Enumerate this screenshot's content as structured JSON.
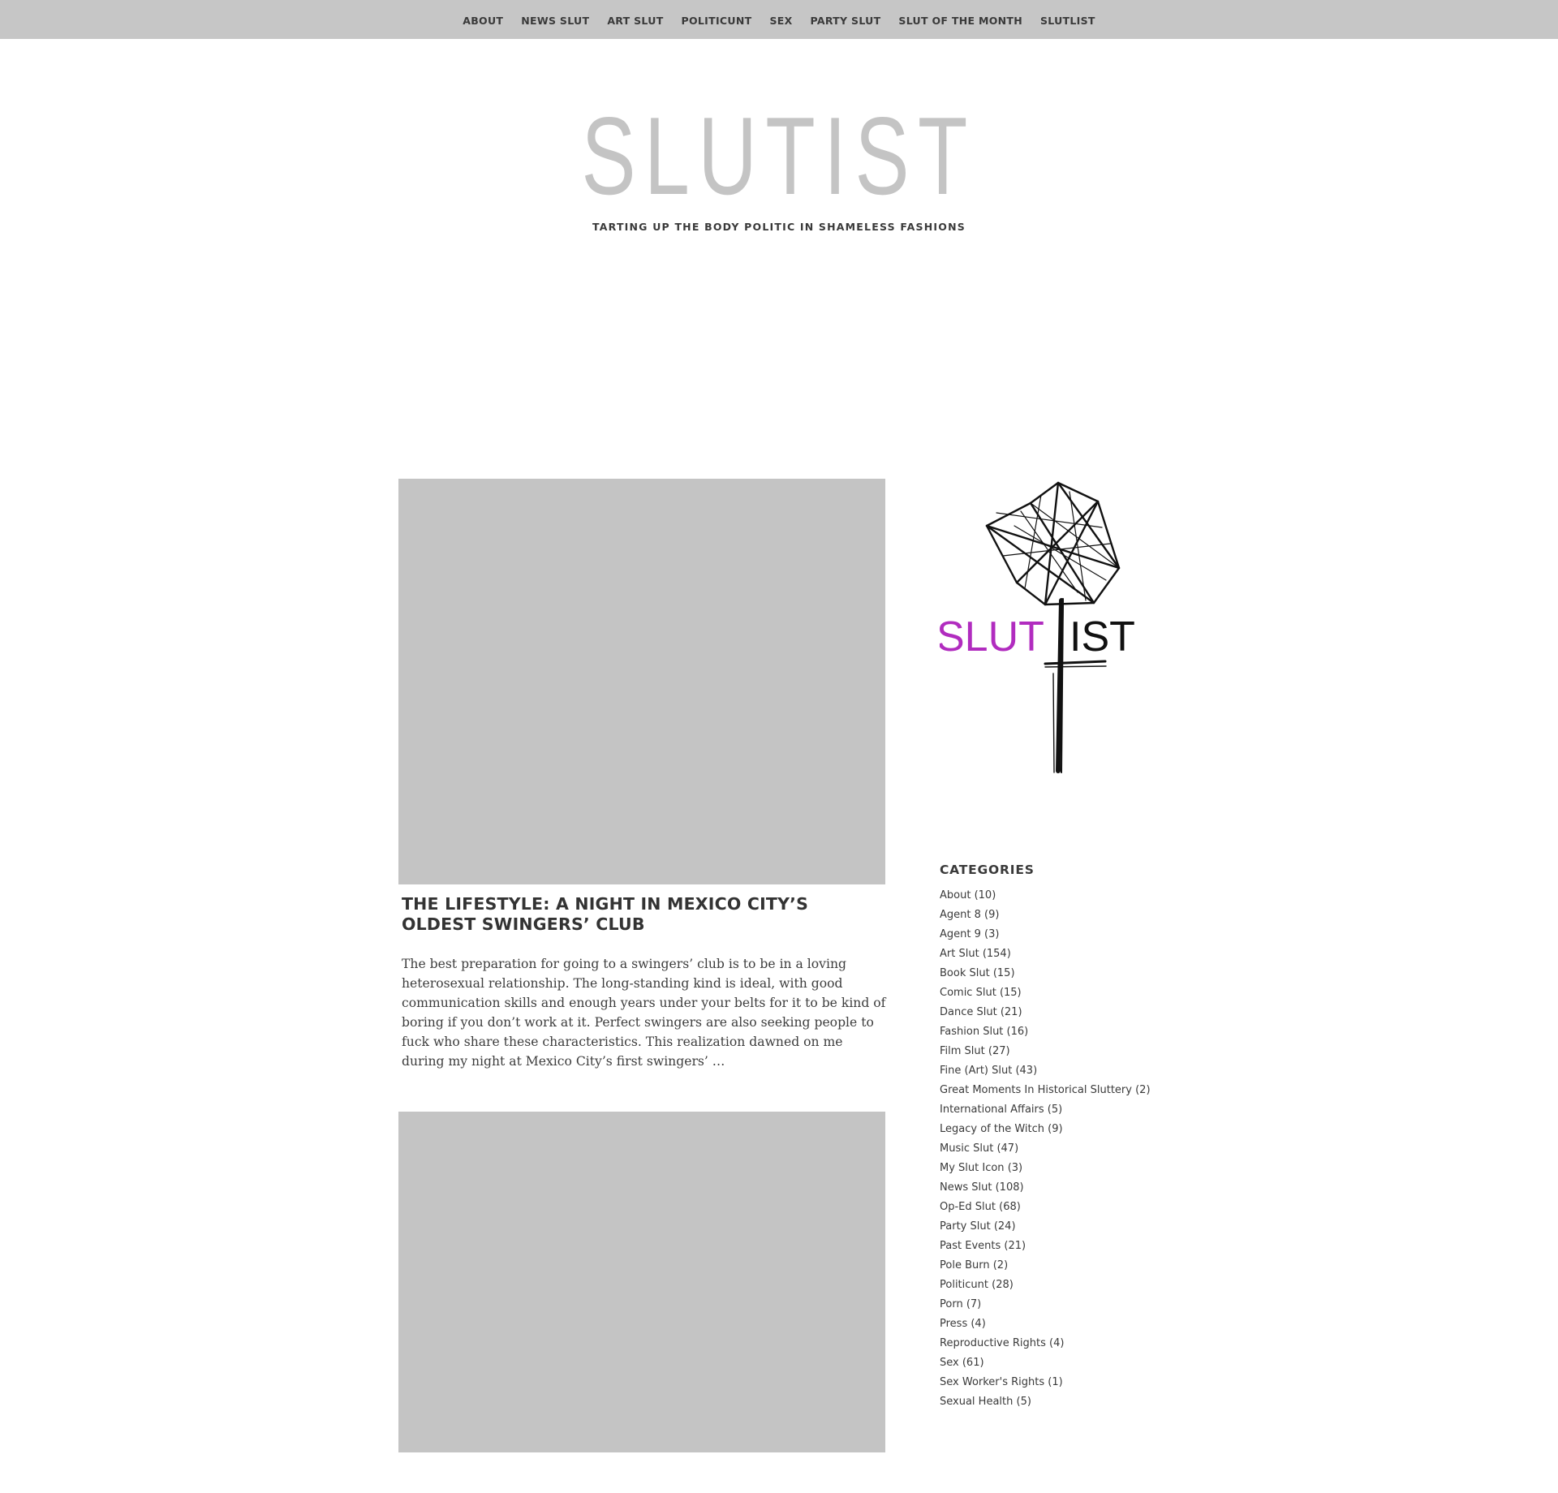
{
  "nav": {
    "items": [
      {
        "label": "ABOUT"
      },
      {
        "label": "NEWS SLUT"
      },
      {
        "label": "ART SLUT"
      },
      {
        "label": "POLITICUNT"
      },
      {
        "label": "SEX"
      },
      {
        "label": "PARTY SLUT"
      },
      {
        "label": "SLUT OF THE MONTH"
      },
      {
        "label": "SLUTLIST"
      }
    ]
  },
  "header": {
    "site_title": "SLUTIST",
    "tagline": "TARTING UP THE BODY POLITIC IN SHAMELESS FASHIONS"
  },
  "posts": [
    {
      "title": "THE LIFESTYLE: A NIGHT IN MEXICO CITY’S OLDEST SWINGERS’ CLUB",
      "excerpt": "The best preparation for going to a swingers’ club is to be in a loving heterosexual relationship. The long-standing kind is ideal, with good communication skills and enough years under your belts for it to be kind of boring if you don’t work at it. Perfect swingers are also seeking people to fuck who share these characteristics. This realization dawned on me during my night at Mexico City’s first swingers’ …"
    }
  ],
  "sidebar": {
    "logo": {
      "text_left": "SLUT",
      "text_right": "IST",
      "accent_color": "#b12cbf"
    },
    "categories_heading": "CATEGORIES",
    "categories": [
      {
        "name": "About",
        "count": "(10)"
      },
      {
        "name": "Agent 8",
        "count": "(9)"
      },
      {
        "name": "Agent 9",
        "count": "(3)"
      },
      {
        "name": "Art Slut",
        "count": "(154)"
      },
      {
        "name": "Book Slut",
        "count": "(15)"
      },
      {
        "name": "Comic Slut",
        "count": "(15)"
      },
      {
        "name": "Dance Slut",
        "count": "(21)"
      },
      {
        "name": "Fashion Slut",
        "count": "(16)"
      },
      {
        "name": "Film Slut",
        "count": "(27)"
      },
      {
        "name": "Fine (Art) Slut",
        "count": "(43)"
      },
      {
        "name": "Great Moments In Historical Sluttery",
        "count": "(2)"
      },
      {
        "name": "International Affairs",
        "count": "(5)"
      },
      {
        "name": "Legacy of the Witch",
        "count": "(9)"
      },
      {
        "name": "Music Slut",
        "count": "(47)"
      },
      {
        "name": "My Slut Icon",
        "count": "(3)"
      },
      {
        "name": "News Slut",
        "count": "(108)"
      },
      {
        "name": "Op-Ed Slut",
        "count": "(68)"
      },
      {
        "name": "Party Slut",
        "count": "(24)"
      },
      {
        "name": "Past Events",
        "count": "(21)"
      },
      {
        "name": "Pole Burn",
        "count": "(2)"
      },
      {
        "name": "Politicunt",
        "count": "(28)"
      },
      {
        "name": "Porn",
        "count": "(7)"
      },
      {
        "name": "Press",
        "count": "(4)"
      },
      {
        "name": "Reproductive Rights",
        "count": "(4)"
      },
      {
        "name": "Sex",
        "count": "(61)"
      },
      {
        "name": "Sex Worker's Rights",
        "count": "(1)"
      },
      {
        "name": "Sexual Health",
        "count": "(5)"
      }
    ]
  },
  "colors": {
    "nav_bg": "#c6c6c6",
    "title_gray": "#c4c4c4",
    "placeholder_gray": "#c4c4c4",
    "logo_accent": "#b12cbf"
  }
}
